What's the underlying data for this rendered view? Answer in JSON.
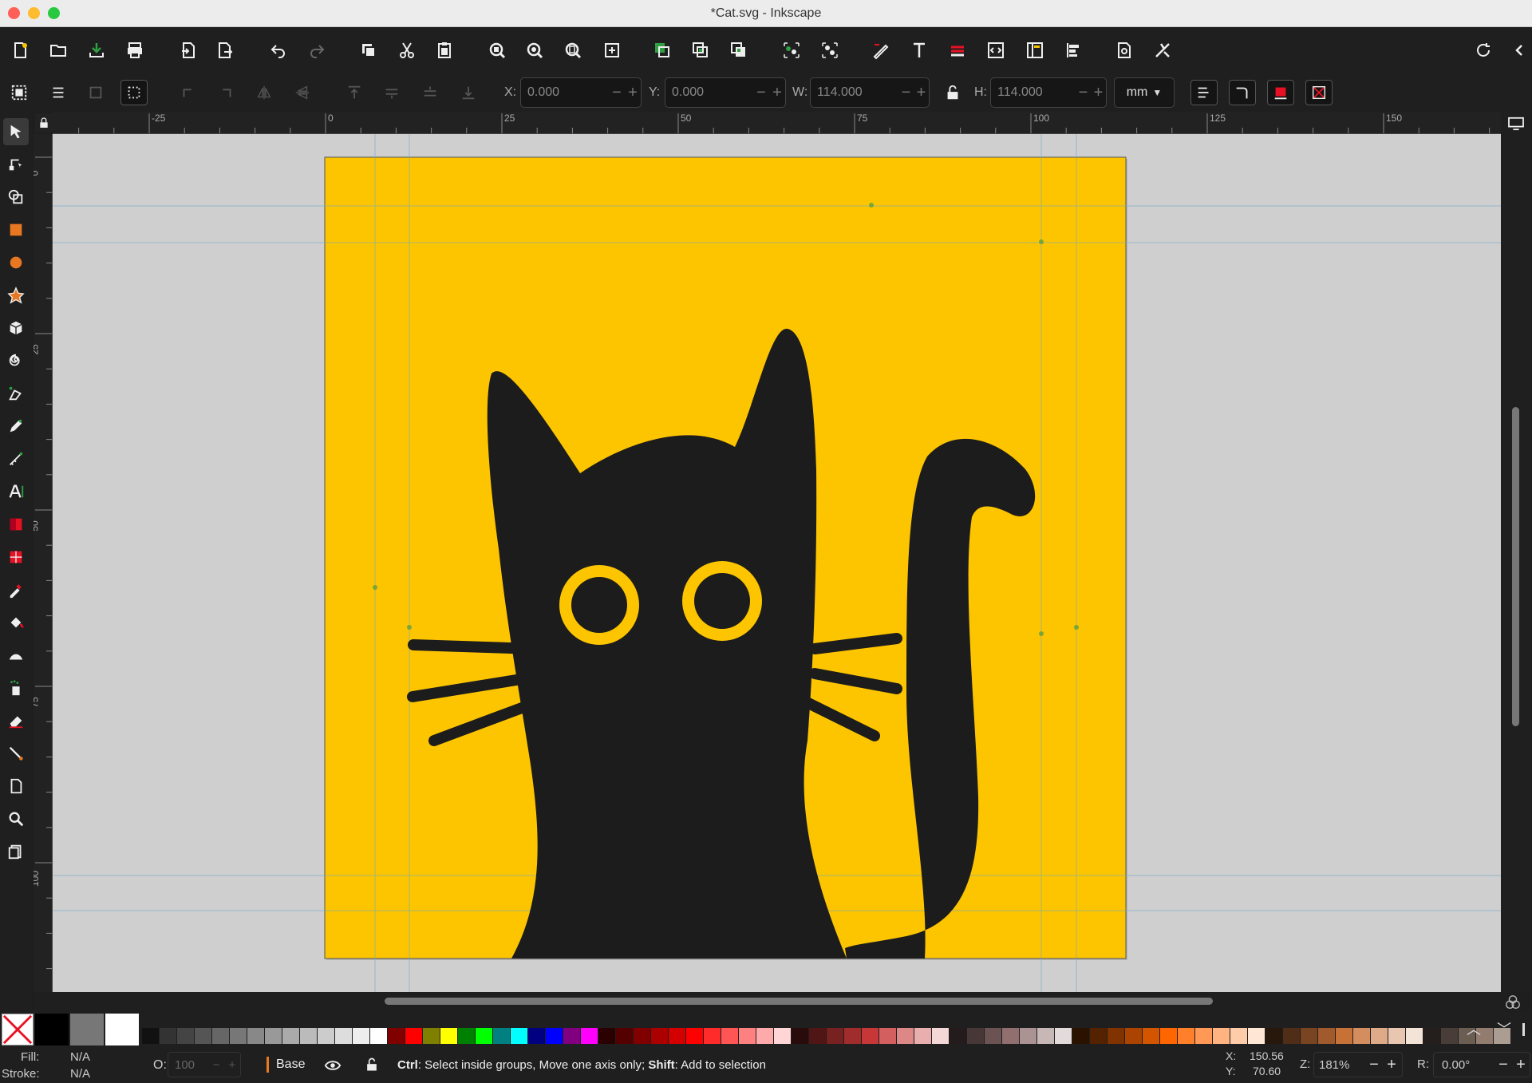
{
  "window": {
    "title": "*Cat.svg - Inkscape"
  },
  "toolbar": {
    "icons": [
      "new-document-icon",
      "open-icon",
      "save-icon",
      "print-icon",
      "import-icon",
      "export-icon",
      "undo-icon",
      "redo-icon",
      "copy-icon",
      "cut-icon",
      "paste-icon",
      "zoom-selection-icon",
      "zoom-drawing-icon",
      "zoom-page-icon",
      "zoom-center-icon",
      "duplicate-icon",
      "clone-icon",
      "unlink-clone-icon",
      "group-icon",
      "ungroup-icon",
      "fill-stroke-icon",
      "text-font-icon",
      "layers-icon",
      "xml-editor-icon",
      "object-properties-icon",
      "align-distribute-icon",
      "document-properties-icon",
      "preferences-icon"
    ]
  },
  "controls": {
    "x_label": "X:",
    "x_value": "0.000",
    "y_label": "Y:",
    "y_value": "0.000",
    "w_label": "W:",
    "w_value": "114.000",
    "h_label": "H:",
    "h_value": "114.000",
    "unit": "mm"
  },
  "ruler": {
    "top_ticks": [
      "-25",
      "0",
      "25",
      "50",
      "75",
      "100",
      "125",
      "150"
    ],
    "left_ticks": [
      "0",
      "25",
      "50",
      "75",
      "100"
    ]
  },
  "statusbar": {
    "fill_label": "Fill:",
    "fill_value": "N/A",
    "stroke_label": "Stroke:",
    "stroke_value": "N/A",
    "opacity_label": "O:",
    "opacity_value": "100",
    "layer_name": "Base",
    "message_ctrl": "Ctrl",
    "message_mid": ": Select inside groups, Move one axis only; ",
    "message_shift": "Shift",
    "message_end": ": Add to selection",
    "cursor_x_label": "X:",
    "cursor_x": "150.56",
    "cursor_y_label": "Y:",
    "cursor_y": "70.60",
    "zoom_label": "Z:",
    "zoom": "181%",
    "rotation_label": "R:",
    "rotation": "0.00°"
  },
  "colors": {
    "page_background": "#fdc500",
    "cat": "#1c1c1c",
    "accent": "#e87722"
  }
}
